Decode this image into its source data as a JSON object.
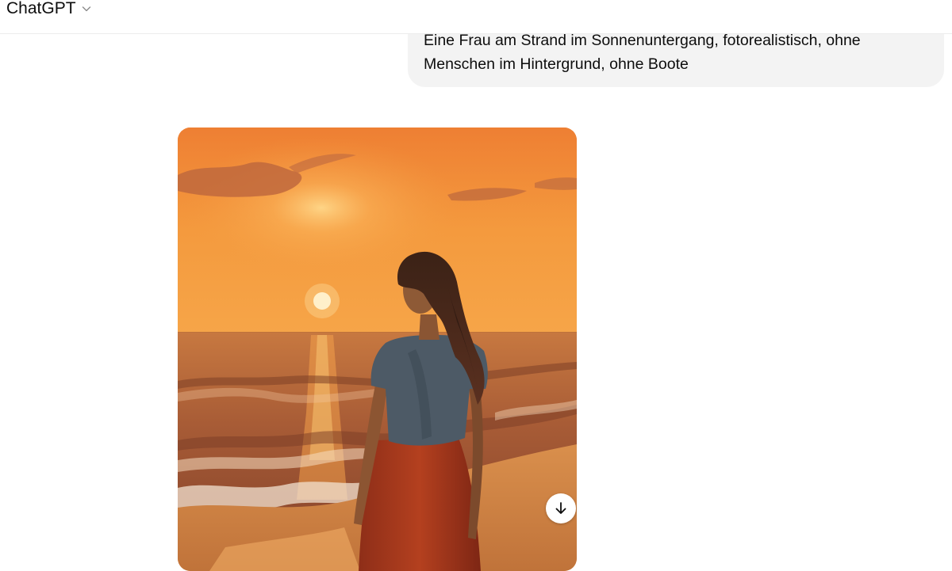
{
  "header": {
    "model_name": "ChatGPT",
    "model_chevron_icon": "chevron-down-icon"
  },
  "conversation": {
    "user_message": {
      "line1": "Eine Frau am Strand im Sonnenuntergang, fotorealistisch, ohne",
      "line2": "Menschen im Hintergrund, ohne Boote"
    },
    "assistant_image": {
      "download_icon": "download-arrow-icon"
    }
  },
  "colors": {
    "sky_top": "#f28b3b",
    "sky_horizon": "#f7a23c",
    "sea": "#b9663a",
    "sand": "#d98a46",
    "sun": "#fff6dc"
  }
}
